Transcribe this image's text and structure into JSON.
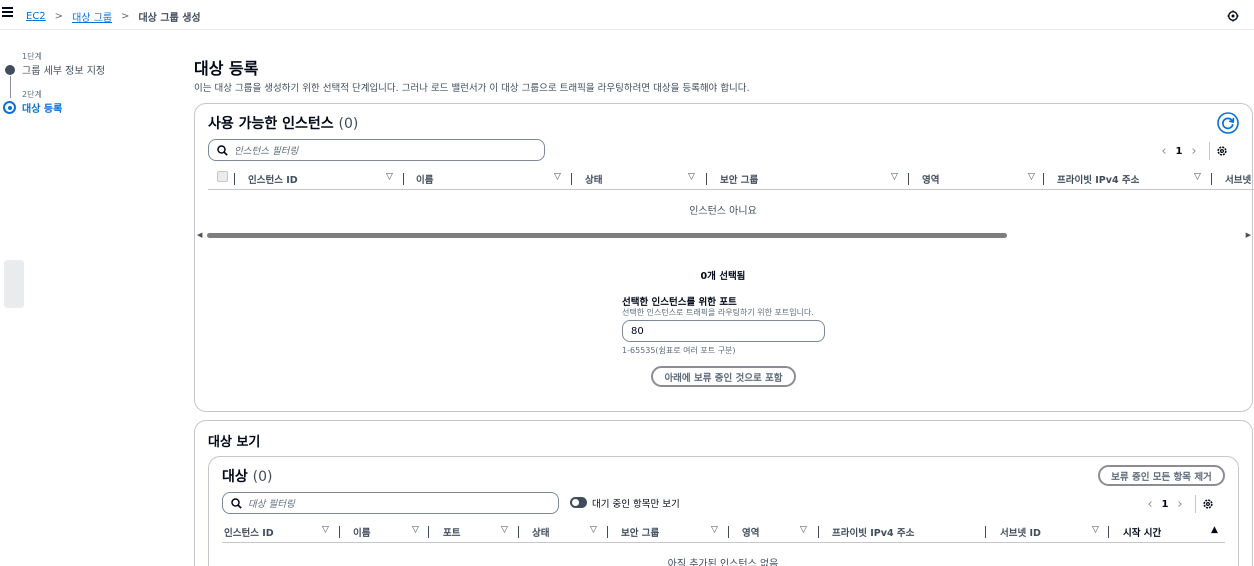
{
  "breadcrumb": {
    "root": "EC2",
    "parent": "대상 그룹",
    "current": "대상 그룹 생성"
  },
  "steps": [
    {
      "num": "1단계",
      "title": "그룹 세부 정보 지정"
    },
    {
      "num": "2단계",
      "title": "대상 등록"
    }
  ],
  "page": {
    "title": "대상 등록",
    "description": "이는 대상 그룹을 생성하기 위한 선택적 단계입니다. 그러나 로드 밸런서가 이 대상 그룹으로 트래픽을 라우팅하려면 대상을 등록해야 합니다."
  },
  "available": {
    "title": "사용 가능한 인스턴스",
    "count": "(0)",
    "search_placeholder": "인스턴스 필터링",
    "page": "1",
    "columns": [
      "인스턴스 ID",
      "이름",
      "상태",
      "보안 그룹",
      "영역",
      "프라이빗 IPv4 주소",
      "서브넷"
    ],
    "empty": "인스턴스 아니요",
    "selected_count": "0개 선택됨",
    "port_label": "선택한 인스턴스를 위한 포트",
    "port_desc": "선택한 인스턴스로 트래픽을 라우팅하기 위한 포트입니다.",
    "port_value": "80",
    "port_hint": "1-65535(쉼표로 여러 포트 구분)",
    "include_button": "아래에 보류 중인 것으로 포함"
  },
  "review": {
    "title": "대상 보기",
    "targets_title": "대상",
    "targets_count": "(0)",
    "remove_all_button": "보류 중인 모든 항목 제거",
    "search_placeholder": "대상 필터링",
    "toggle_label": "대기 중인 항목만 보기",
    "page": "1",
    "columns": [
      "인스턴스 ID",
      "이름",
      "포트",
      "상태",
      "보안 그룹",
      "영역",
      "프라이빗 IPv4 주소",
      "서브넷 ID",
      "시작 시간"
    ],
    "empty": "아직 추가된 인스턴스 없음"
  },
  "colors": {
    "link": "#0972d3",
    "text": "#000716",
    "border": "#c6c6cd"
  }
}
